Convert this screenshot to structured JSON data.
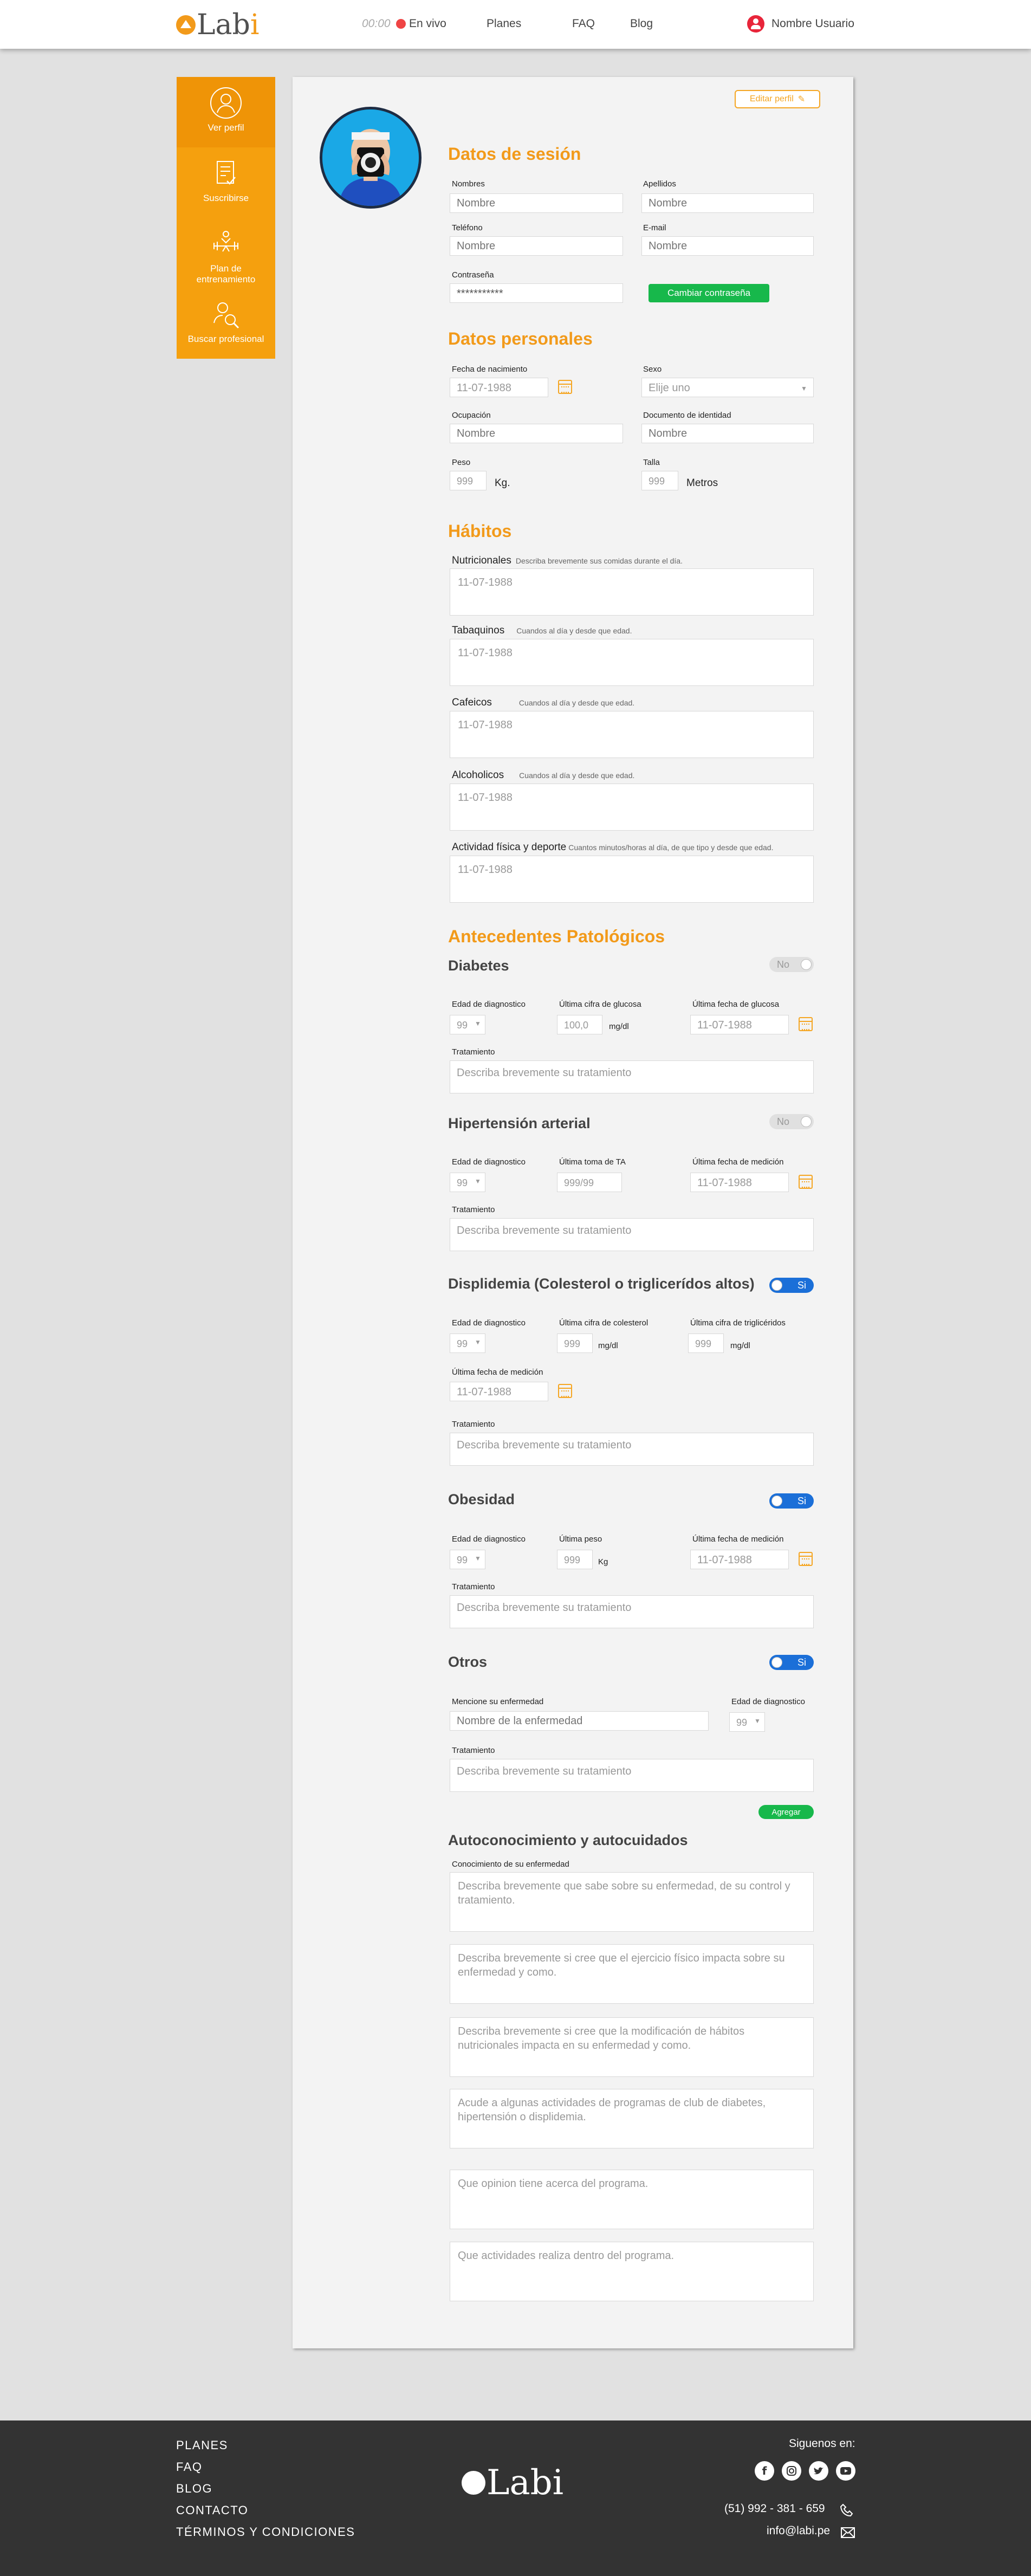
{
  "header": {
    "brand": "Lab",
    "brand_accent": "i",
    "live_time": "00:00",
    "live_label": "En vivo",
    "nav": [
      "Planes",
      "FAQ",
      "Blog"
    ],
    "user_name": "Nombre Usuario"
  },
  "sidebar": {
    "items": [
      {
        "label": "Ver perfil",
        "icon": "user-icon"
      },
      {
        "label": "Suscribirse",
        "icon": "checklist-icon"
      },
      {
        "label": "Plan de entrenamiento",
        "icon": "dumbbell-icon"
      },
      {
        "label": "Buscar profesional",
        "icon": "search-user-icon"
      }
    ]
  },
  "profile": {
    "edit_label": "Editar perfil"
  },
  "sesion": {
    "title": "Datos de sesión",
    "nombres_label": "Nombres",
    "nombres_ph": "Nombre",
    "apellidos_label": "Apellidos",
    "apellidos_ph": "Nombre",
    "telefono_label": "Teléfono",
    "telefono_ph": "Nombre",
    "email_label": "E-mail",
    "email_ph": "Nombre",
    "password_label": "Contraseña",
    "password_value": "***********",
    "change_password": "Cambiar contraseña"
  },
  "personales": {
    "title": "Datos personales",
    "nacimiento_label": "Fecha de nacimiento",
    "nacimiento_value": "11-07-1988",
    "sexo_label": "Sexo",
    "sexo_value": "Elije uno",
    "ocupacion_label": "Ocupación",
    "ocupacion_ph": "Nombre",
    "documento_label": "Documento de identidad",
    "documento_ph": "Nombre",
    "peso_label": "Peso",
    "peso_value": "999",
    "peso_unit": "Kg.",
    "talla_label": "Talla",
    "talla_value": "999",
    "talla_unit": "Metros"
  },
  "habitos": {
    "title": "Hábitos",
    "items": [
      {
        "label": "Nutricionales",
        "hint": "Describa brevemente sus comidas durante el día.",
        "value": "11-07-1988"
      },
      {
        "label": "Tabaquinos",
        "hint": "Cuandos al día y desde que edad.",
        "value": "11-07-1988"
      },
      {
        "label": "Cafeicos",
        "hint": "Cuandos al día y desde que edad.",
        "value": "11-07-1988"
      },
      {
        "label": "Alcoholicos",
        "hint": "Cuandos al día y desde que edad.",
        "value": "11-07-1988"
      },
      {
        "label": "Actividad física y deporte",
        "hint": "Cuantos minutos/horas al día, de que tipo y desde que edad.",
        "value": "11-07-1988"
      }
    ]
  },
  "patologicos": {
    "title": "Antecedentes Patológicos",
    "tratamiento_label": "Tratamiento",
    "tratamiento_ph": "Describa brevemente su tratamiento",
    "edad_label": "Edad de diagnostico",
    "edad_value": "99",
    "fecha_value": "11-07-1988",
    "toggle_no": "No",
    "toggle_yes": "Si",
    "diabetes": {
      "title": "Diabetes",
      "state": "No",
      "glucosa_label": "Última cifra de glucosa",
      "glucosa_value": "100,0",
      "glucosa_unit": "mg/dl",
      "fecha_label": "Última fecha de glucosa"
    },
    "hipertension": {
      "title": "Hipertensión arterial",
      "state": "No",
      "ta_label": "Última toma de TA",
      "ta_value": "999/99",
      "fecha_label": "Última fecha de medición"
    },
    "dislipidemia": {
      "title": "Displidemia (Colesterol o triglicerídos altos)",
      "state": "Si",
      "col_label": "Última cifra de colesterol",
      "col_value": "999",
      "col_unit": "mg/dl",
      "tri_label": "Última cifra de triglicéridos",
      "tri_value": "999",
      "tri_unit": "mg/dl",
      "fecha_label": "Última fecha de medición"
    },
    "obesidad": {
      "title": "Obesidad",
      "state": "Si",
      "peso_label": "Última peso",
      "peso_value": "999",
      "peso_unit": "Kg",
      "fecha_label": "Última fecha de medición"
    },
    "otros": {
      "title": "Otros",
      "state": "Si",
      "enf_label": "Mencione su enfermedad",
      "enf_ph": "Nombre de la enfermedad",
      "add_label": "Agregar"
    }
  },
  "autoconocimiento": {
    "title": "Autoconocimiento y autocuidados",
    "label": "Conocimiento de su enfermedad",
    "items": [
      "Describa brevemente que sabe sobre su enfermedad, de su control y tratamiento.",
      "Describa brevemente si cree que el ejercicio físico impacta sobre su enfermedad y como.",
      "Describa brevemente si cree que la modificación de hábitos nutricionales impacta en su enfermedad y como.",
      "Acude a algunas actividades de programas de club de diabetes, hipertensión o displidemia.",
      "Que opinion tiene acerca del programa.",
      "Que actividades realiza dentro del programa."
    ]
  },
  "footer": {
    "links": [
      "PLANES",
      "FAQ",
      "BLOG",
      "CONTACTO",
      "TÉRMINOS Y CONDICIONES"
    ],
    "follow": "Siguenos en:",
    "phone": "(51) 992 - 381 - 659",
    "email": "info@labi.pe"
  }
}
